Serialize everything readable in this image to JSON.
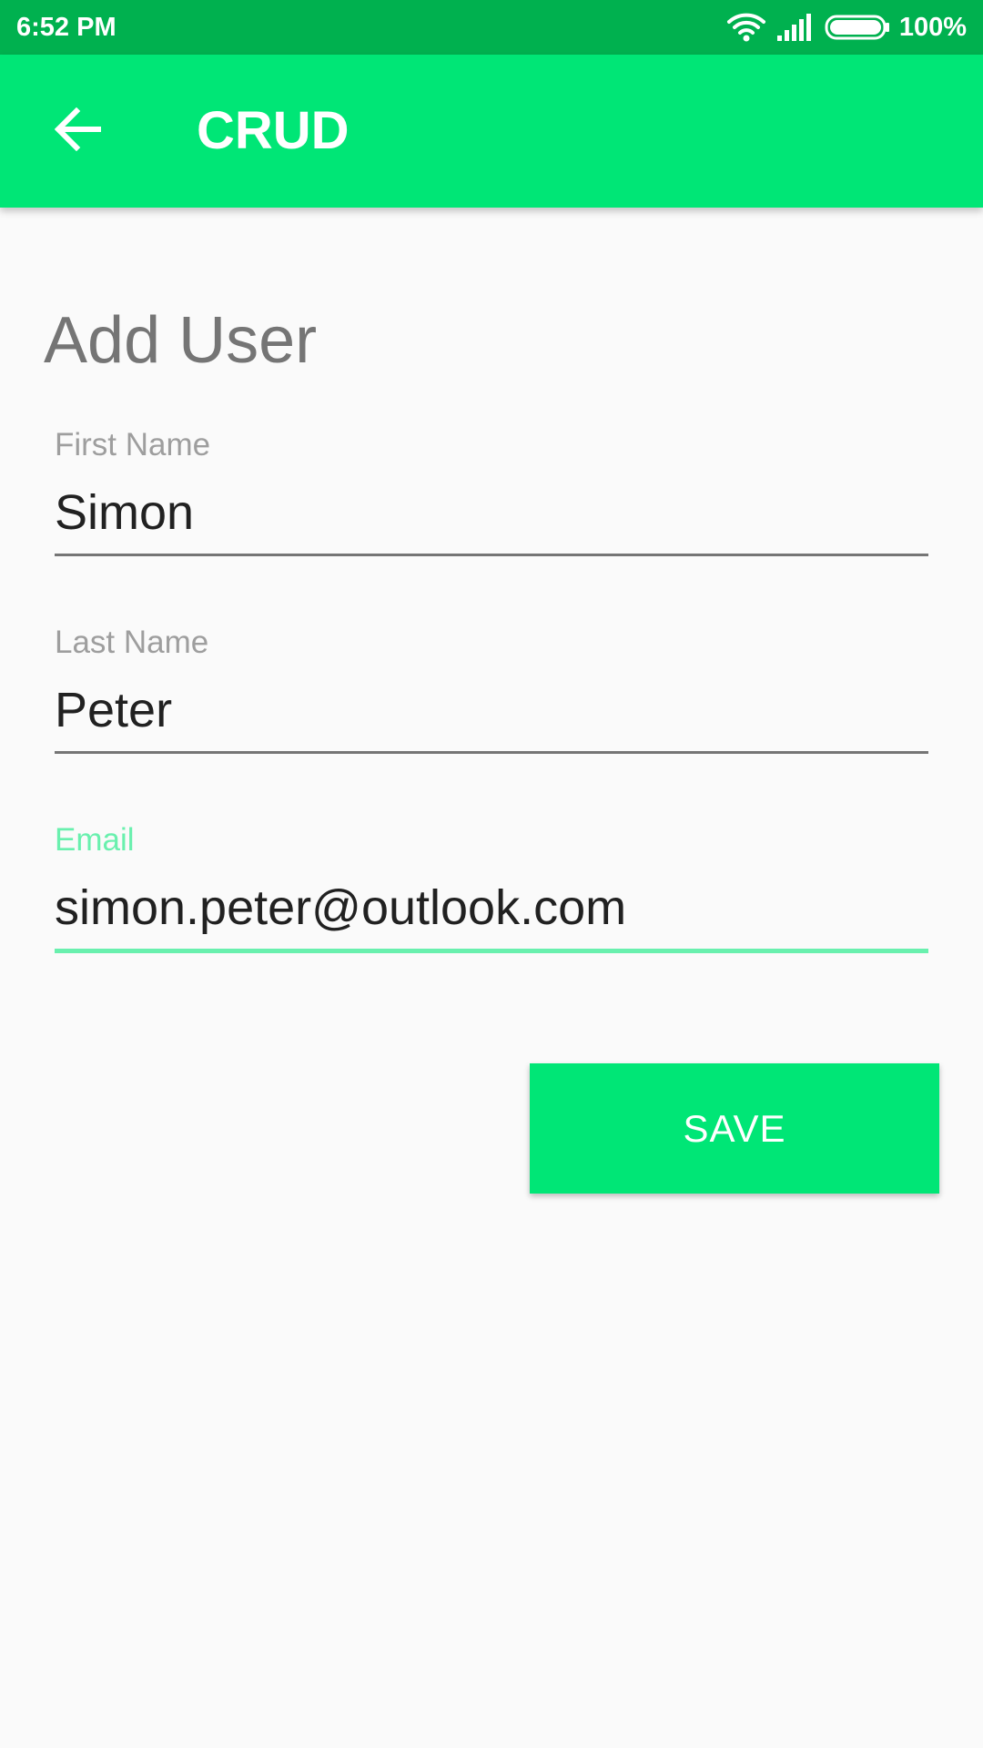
{
  "status_bar": {
    "time": "6:52 PM",
    "battery": "100%",
    "icons": [
      "wifi-icon",
      "signal-icon",
      "battery-icon"
    ]
  },
  "app_bar": {
    "title": "CRUD",
    "back_icon": "arrow-left-icon"
  },
  "form": {
    "title": "Add User",
    "fields": [
      {
        "label": "First Name",
        "value": "Simon",
        "focused": false
      },
      {
        "label": "Last Name",
        "value": "Peter",
        "focused": false
      },
      {
        "label": "Email",
        "value": "simon.peter@outlook.com",
        "focused": true
      }
    ],
    "save_label": "SAVE"
  },
  "colors": {
    "status_bar": "#00b14f",
    "primary": "#00e676",
    "accent": "#69f0ae",
    "background": "#fafafa"
  }
}
